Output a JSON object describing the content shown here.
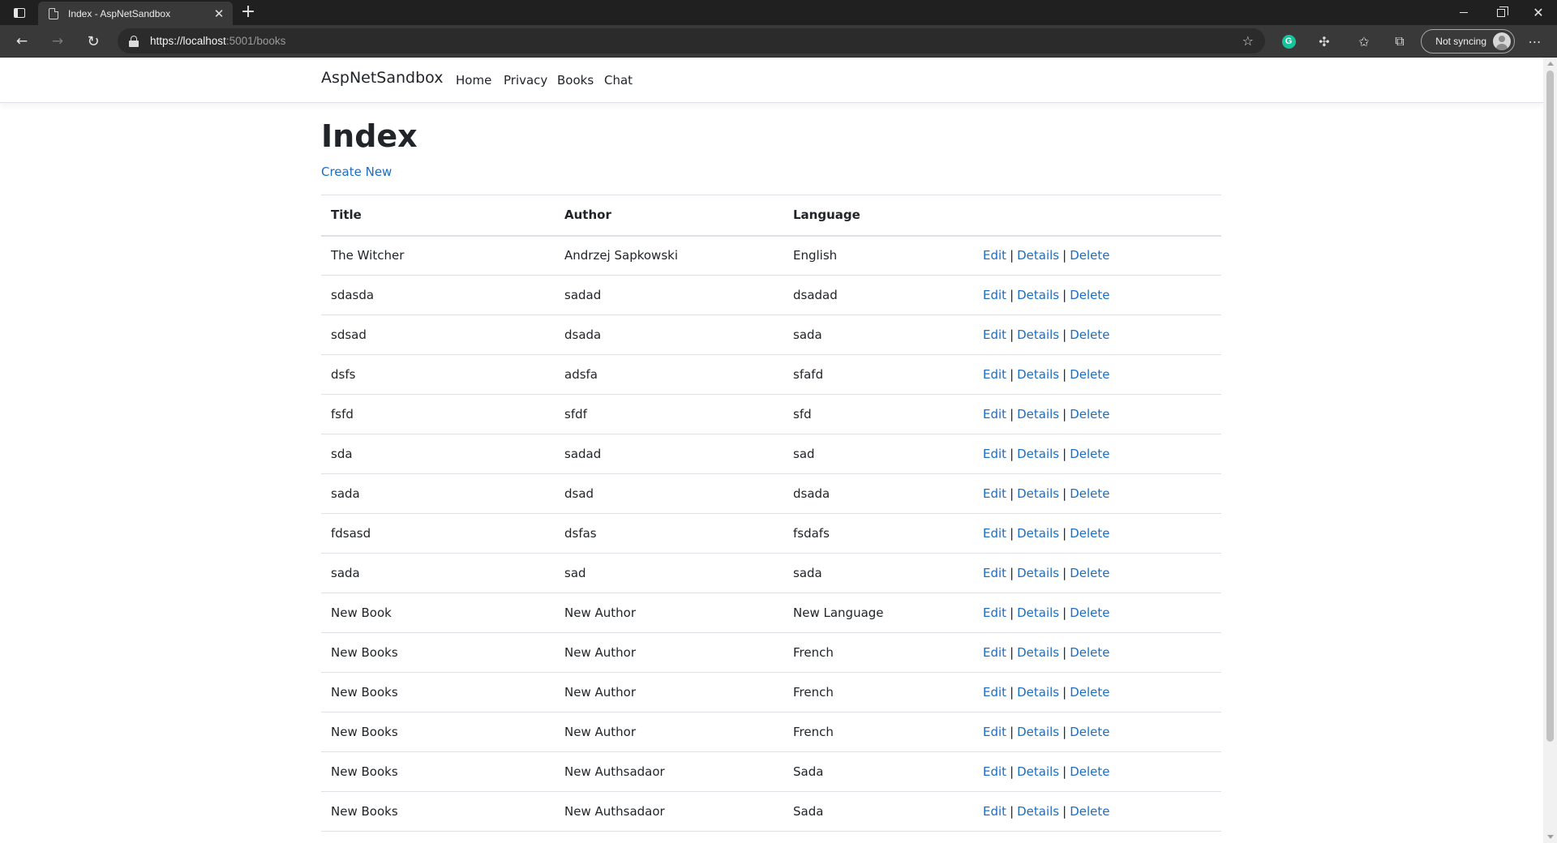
{
  "browser": {
    "tab_title": "Index - AspNetSandbox",
    "tab_close": "✕",
    "new_tab": "+",
    "url_host": "https://localhost",
    "url_rest": ":5001/books",
    "sync_label": "Not syncing",
    "win_close": "✕",
    "back_glyph": "←",
    "forward_glyph": "→",
    "reload_glyph": "↻",
    "more_glyph": "⋯"
  },
  "site": {
    "brand": "AspNetSandbox",
    "nav": [
      "Home",
      "Privacy",
      "Books",
      "Chat"
    ]
  },
  "page": {
    "title": "Index",
    "create_link": "Create New"
  },
  "table": {
    "headers": [
      "Title",
      "Author",
      "Language",
      ""
    ],
    "actions": [
      "Edit",
      "Details",
      "Delete"
    ],
    "separator": "|",
    "rows": [
      [
        "The Witcher",
        "Andrzej Sapkowski",
        "English"
      ],
      [
        "sdasda",
        "sadad",
        "dsadad"
      ],
      [
        "sdsad",
        "dsada",
        "sada"
      ],
      [
        "dsfs",
        "adsfa",
        "sfafd"
      ],
      [
        "fsfd",
        "sfdf",
        "sfd"
      ],
      [
        "sda",
        "sadad",
        "sad"
      ],
      [
        "sada",
        "dsad",
        "dsada"
      ],
      [
        "fdsasd",
        "dsfas",
        "fsdafs"
      ],
      [
        "sada",
        "sad",
        "sada"
      ],
      [
        "New Book",
        "New Author",
        "New Language"
      ],
      [
        "New Books",
        "New Author",
        "French"
      ],
      [
        "New Books",
        "New Author",
        "French"
      ],
      [
        "New Books",
        "New Author",
        "French"
      ],
      [
        "New Books",
        "New Authsadaor",
        "Sada"
      ],
      [
        "New Books",
        "New Authsadaor",
        "Sada"
      ]
    ]
  },
  "colors": {
    "link": "#1b6ec2",
    "text": "#212529",
    "border": "#dee2e6",
    "chrome_dark": "#202020",
    "chrome_toolbar": "#393939"
  },
  "icons": {
    "window_menu": "window-menu-icon",
    "page": "page-icon",
    "lock": "lock-icon",
    "favorite_add": "star-plus-icon",
    "grammarly": "grammarly-icon",
    "extensions": "puzzle-icon",
    "favorites": "favorites-icon",
    "collections": "collections-icon"
  }
}
